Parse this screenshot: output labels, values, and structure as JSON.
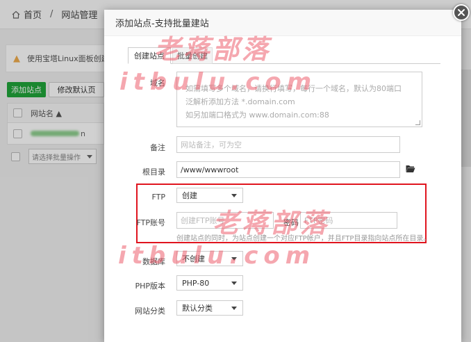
{
  "background": {
    "breadcrumb": {
      "home": "首页",
      "separator": "/",
      "current": "网站管理"
    },
    "notice_text": "使用宝塔Linux面板创建站",
    "add_site_button": "添加站点",
    "default_page_button": "修改默认页",
    "table_header_site_name": "网站名 ▲",
    "site_suffix": "n",
    "batch_select_placeholder": "请选择批量操作"
  },
  "modal": {
    "title": "添加站点-支持批量建站",
    "tabs": [
      {
        "label": "创建站点",
        "active": true
      },
      {
        "label": "批量创建",
        "active": false
      }
    ],
    "domain": {
      "label": "域名",
      "placeholder_lines": [
        "如需填写多个域名，请换行填写，每行一个域名，默认为80端口",
        "泛解析添加方法 *.domain.com",
        "如另加端口格式为 www.domain.com:88"
      ]
    },
    "remark": {
      "label": "备注",
      "placeholder": "网站备注，可为空"
    },
    "root_dir": {
      "label": "根目录",
      "value": "/www/wwwroot"
    },
    "ftp": {
      "label": "FTP",
      "value": "创建",
      "account_label": "FTP账号",
      "account_placeholder": "创建FTP账号",
      "password_label": "密码",
      "password_placeholder": "FTP密码",
      "hint": "创建站点的同时，为站点创建一个对应FTP帐户，并且FTP目录指向站点所在目录。",
      "highlight_color": "#e0141e"
    },
    "database": {
      "label": "数据库",
      "value": "不创建"
    },
    "php_version": {
      "label": "PHP版本",
      "value": "PHP-80"
    },
    "site_category": {
      "label": "网站分类",
      "value": "默认分类"
    }
  },
  "watermark": {
    "cn": "老蒋部落",
    "en": "itbulu.com"
  },
  "colors": {
    "primary_green": "#20a53a",
    "warning": "#f0ad4e",
    "watermark": "#ec5f6e"
  }
}
